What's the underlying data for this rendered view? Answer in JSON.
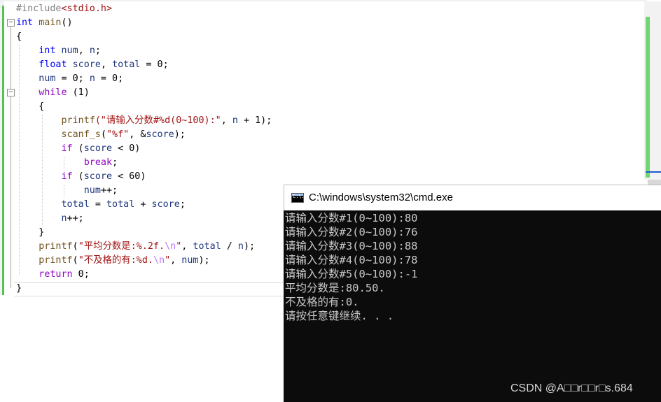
{
  "editor": {
    "lines": [
      [
        {
          "t": "#include",
          "c": "pp"
        },
        {
          "t": "<stdio.h>",
          "c": "inc"
        }
      ],
      [
        {
          "t": "int",
          "c": "kw"
        },
        {
          "t": " "
        },
        {
          "t": "main",
          "c": "fn"
        },
        {
          "t": "()"
        }
      ],
      [
        {
          "t": "{"
        }
      ],
      [
        {
          "t": "    "
        },
        {
          "t": "int",
          "c": "kw"
        },
        {
          "t": " "
        },
        {
          "t": "num",
          "c": "var"
        },
        {
          "t": ", "
        },
        {
          "t": "n",
          "c": "var"
        },
        {
          "t": ";"
        }
      ],
      [
        {
          "t": "    "
        },
        {
          "t": "float",
          "c": "kw"
        },
        {
          "t": " "
        },
        {
          "t": "score",
          "c": "var"
        },
        {
          "t": ", "
        },
        {
          "t": "total",
          "c": "var"
        },
        {
          "t": " = 0;"
        }
      ],
      [
        {
          "t": "    "
        },
        {
          "t": "num",
          "c": "var"
        },
        {
          "t": " = 0; "
        },
        {
          "t": "n",
          "c": "var"
        },
        {
          "t": " = 0;"
        }
      ],
      [
        {
          "t": "    "
        },
        {
          "t": "while",
          "c": "kw2"
        },
        {
          "t": " (1)"
        }
      ],
      [
        {
          "t": "    {"
        }
      ],
      [
        {
          "t": "        "
        },
        {
          "t": "printf",
          "c": "fn"
        },
        {
          "t": "(\"请输入分数#%d(0~100):\"",
          "c": "str"
        },
        {
          "t": ", "
        },
        {
          "t": "n",
          "c": "var"
        },
        {
          "t": " + 1);"
        }
      ],
      [
        {
          "t": "        "
        },
        {
          "t": "scanf_s",
          "c": "fn"
        },
        {
          "t": "("
        },
        {
          "t": "\"%f\"",
          "c": "str"
        },
        {
          "t": ", &"
        },
        {
          "t": "score",
          "c": "var"
        },
        {
          "t": ");"
        }
      ],
      [
        {
          "t": "        "
        },
        {
          "t": "if",
          "c": "kw2"
        },
        {
          "t": " ("
        },
        {
          "t": "score",
          "c": "var"
        },
        {
          "t": " < 0)"
        }
      ],
      [
        {
          "t": "            "
        },
        {
          "t": "break",
          "c": "kw2"
        },
        {
          "t": ";"
        }
      ],
      [
        {
          "t": "        "
        },
        {
          "t": "if",
          "c": "kw2"
        },
        {
          "t": " ("
        },
        {
          "t": "score",
          "c": "var"
        },
        {
          "t": " < 60)"
        }
      ],
      [
        {
          "t": "            "
        },
        {
          "t": "num",
          "c": "var"
        },
        {
          "t": "++;"
        }
      ],
      [
        {
          "t": "        "
        },
        {
          "t": "total",
          "c": "var"
        },
        {
          "t": " = "
        },
        {
          "t": "total",
          "c": "var"
        },
        {
          "t": " + "
        },
        {
          "t": "score",
          "c": "var"
        },
        {
          "t": ";"
        }
      ],
      [
        {
          "t": "        "
        },
        {
          "t": "n",
          "c": "var"
        },
        {
          "t": "++;"
        }
      ],
      [
        {
          "t": "    }"
        }
      ],
      [
        {
          "t": "    "
        },
        {
          "t": "printf",
          "c": "fn"
        },
        {
          "t": "("
        },
        {
          "t": "\"平均分数是:%.2f.",
          "c": "str"
        },
        {
          "t": "\\n",
          "c": "esc"
        },
        {
          "t": "\"",
          "c": "str"
        },
        {
          "t": ", "
        },
        {
          "t": "total",
          "c": "var"
        },
        {
          "t": " / "
        },
        {
          "t": "n",
          "c": "var"
        },
        {
          "t": ");"
        }
      ],
      [
        {
          "t": "    "
        },
        {
          "t": "printf",
          "c": "fn"
        },
        {
          "t": "("
        },
        {
          "t": "\"不及格的有:%d.",
          "c": "str"
        },
        {
          "t": "\\n",
          "c": "esc"
        },
        {
          "t": "\"",
          "c": "str"
        },
        {
          "t": ", "
        },
        {
          "t": "num",
          "c": "var"
        },
        {
          "t": ");"
        }
      ],
      [
        {
          "t": "    "
        },
        {
          "t": "return",
          "c": "kw2"
        },
        {
          "t": " 0;"
        }
      ],
      [
        {
          "t": "}"
        }
      ]
    ],
    "fold_glyph": "−"
  },
  "cmd": {
    "title": "C:\\windows\\system32\\cmd.exe",
    "icon_label": "C:\\.",
    "icon_name": "console-icon",
    "output": [
      "请输入分数#1(0~100):80",
      "请输入分数#2(0~100):76",
      "请输入分数#3(0~100):88",
      "请输入分数#4(0~100):78",
      "请输入分数#5(0~100):-1",
      "平均分数是:80.50.",
      "不及格的有:0.",
      "请按任意键继续. . ."
    ]
  },
  "watermark": "CSDN @A□□r□□r□s.684",
  "colors": {
    "keyword": "#0000ff",
    "control_keyword": "#8f08c4",
    "string": "#a31515",
    "function": "#74531f",
    "variable": "#1f377f",
    "change_bar": "#57c157",
    "console_bg": "#0c0c0c",
    "console_text": "#c8c8c8"
  }
}
